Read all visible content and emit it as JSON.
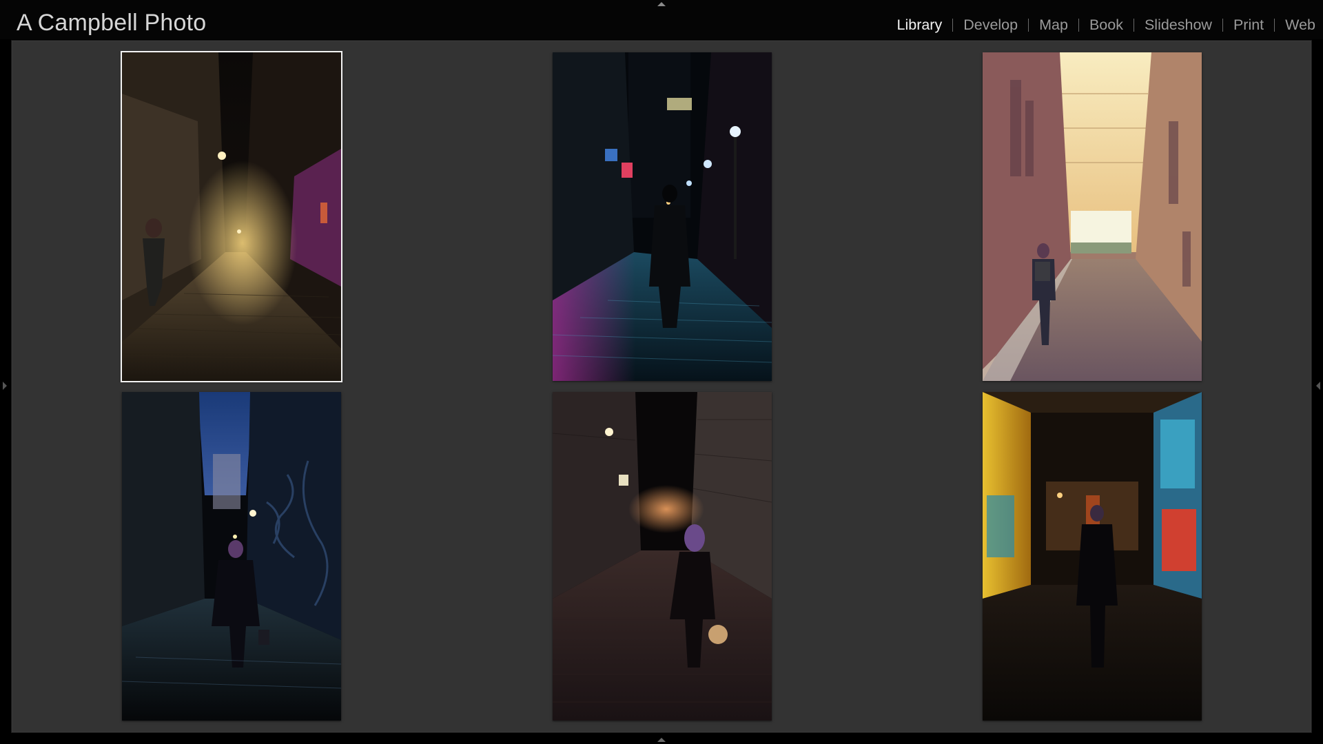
{
  "header": {
    "identity_plate": "A Campbell Photo",
    "modules": [
      {
        "label": "Library",
        "active": true
      },
      {
        "label": "Develop",
        "active": false
      },
      {
        "label": "Map",
        "active": false
      },
      {
        "label": "Book",
        "active": false
      },
      {
        "label": "Slideshow",
        "active": false
      },
      {
        "label": "Print",
        "active": false
      },
      {
        "label": "Web",
        "active": false
      }
    ]
  },
  "colors": {
    "background": "#333333",
    "selection_border": "#f4f4f4",
    "active_module": "#f2f2f2",
    "inactive_module": "#9a9a9a"
  },
  "grid": {
    "columns": 3,
    "rows": 2,
    "selected_index": 0,
    "photos": [
      {
        "subject": "night cobblestone alley with woman and street lamp",
        "palette": [
          "#0b0908",
          "#3a2e22",
          "#6b5a3e",
          "#6a2a6a"
        ]
      },
      {
        "subject": "figure in coat walking down neon-lit wet alley",
        "palette": [
          "#05080c",
          "#13293a",
          "#2b6f8a",
          "#8a2a7a"
        ]
      },
      {
        "subject": "woman with backpack walking down sunlit alley",
        "palette": [
          "#6b4a4a",
          "#a07a6a",
          "#e8c48a",
          "#f6e6b0"
        ]
      },
      {
        "subject": "woman with handbag in graffiti laneway at dusk",
        "palette": [
          "#07090d",
          "#141c26",
          "#24364a",
          "#1a3a6a"
        ]
      },
      {
        "subject": "woman with purple hair walking down brick lane at night",
        "palette": [
          "#090708",
          "#231a1c",
          "#4a3532",
          "#c97a4a"
        ]
      },
      {
        "subject": "woman walking through arcade with illuminated posters",
        "palette": [
          "#050505",
          "#201912",
          "#6a4a18",
          "#e0a030"
        ]
      }
    ]
  }
}
